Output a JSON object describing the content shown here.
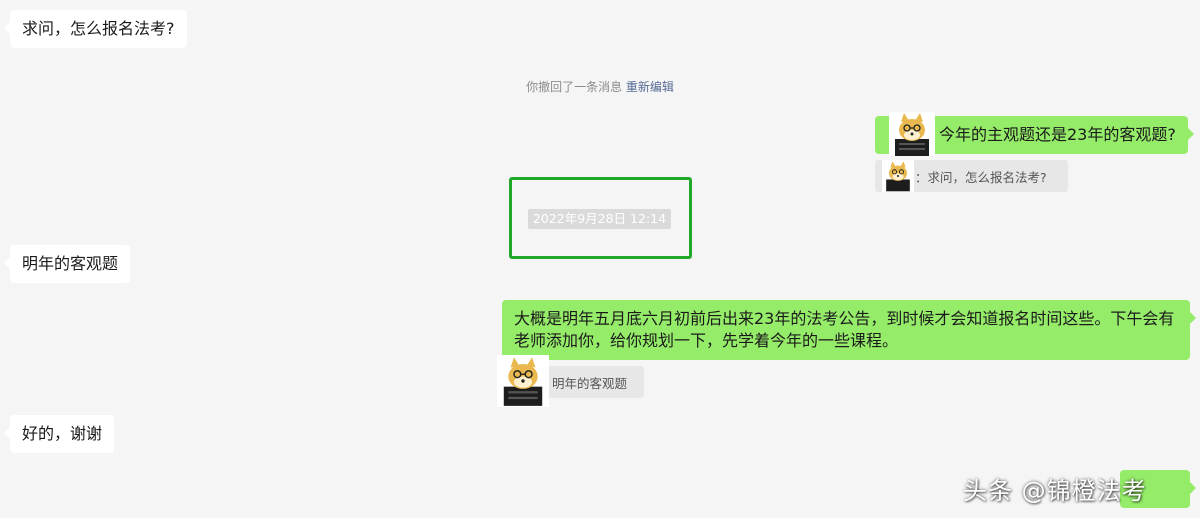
{
  "messages": {
    "m1_text": "求问，怎么报名法考?",
    "m2_text": "今年的主观题还是23年的客观题?",
    "m2_quote": "：求问，怎么报名法考?",
    "m3_text": "明年的客观题",
    "m4_text": "大概是明年五月底六月初前后出来23年的法考公告，到时候才会知道报名时间这些。下午会有老师添加你，给你规划一下，先学着今年的一些课程。",
    "m4_quote": "明年的客观题",
    "m5_text": "好的，谢谢"
  },
  "system": {
    "recall_text": "你撤回了一条消息",
    "reedit_link": "重新编辑"
  },
  "timestamp": "2022年9月28日 12:14",
  "watermark": "头条 @锦橙法考",
  "colors": {
    "background": "#f5f5f5",
    "incoming_bubble": "#ffffff",
    "outgoing_bubble": "#95ec69",
    "highlight_box": "#21a829",
    "link": "#576b95"
  },
  "avatar_icon": "doge-avatar-icon"
}
